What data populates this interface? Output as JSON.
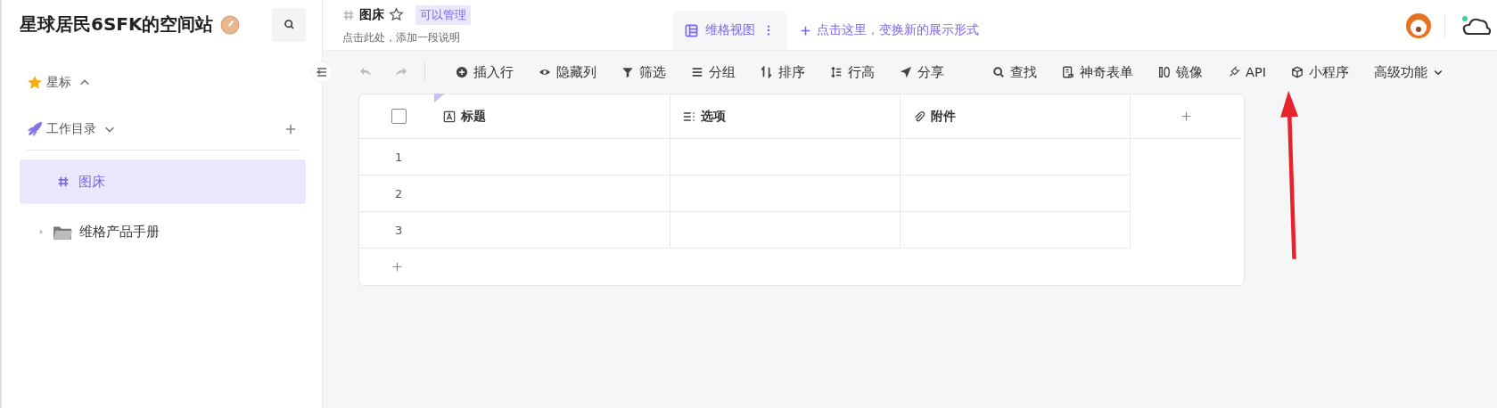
{
  "sidebar": {
    "title": "星球居民6SFK的空间站",
    "sections": [
      {
        "label": "星标",
        "kind": "star",
        "expanded": true
      },
      {
        "label": "工作目录",
        "kind": "catalog",
        "expanded": false
      }
    ],
    "items": [
      {
        "label": "图床",
        "kind": "datasheet",
        "selected": true
      },
      {
        "label": "维格产品手册",
        "kind": "folder",
        "selected": false
      }
    ]
  },
  "header": {
    "title": "图床",
    "badge": "可以管理",
    "description": "点击此处，添加一段说明",
    "views": [
      {
        "label": "维格视图",
        "selected": true
      }
    ],
    "add_view": "点击这里，变换新的展示形式"
  },
  "toolbar": [
    {
      "label": "插入行",
      "kind": "insert"
    },
    {
      "label": "隐藏列",
      "kind": "hide"
    },
    {
      "label": "筛选",
      "kind": "filter"
    },
    {
      "label": "分组",
      "kind": "group"
    },
    {
      "label": "排序",
      "kind": "sort"
    },
    {
      "label": "行高",
      "kind": "height"
    },
    {
      "label": "分享",
      "kind": "share"
    },
    {
      "label": "查找",
      "kind": "search"
    },
    {
      "label": "神奇表单",
      "kind": "form"
    },
    {
      "label": "镜像",
      "kind": "mirror"
    },
    {
      "label": "API",
      "kind": "api"
    },
    {
      "label": "小程序",
      "kind": "widget"
    },
    {
      "label": "高级功能",
      "kind": "more"
    }
  ],
  "table": {
    "select_all_checked": false,
    "columns": [
      {
        "label": "标题",
        "kind": "text"
      },
      {
        "label": "选项",
        "kind": "select"
      },
      {
        "label": "附件",
        "kind": "attachment"
      }
    ],
    "rows": [
      {
        "number": "1"
      },
      {
        "number": "2"
      },
      {
        "number": "3"
      }
    ]
  }
}
